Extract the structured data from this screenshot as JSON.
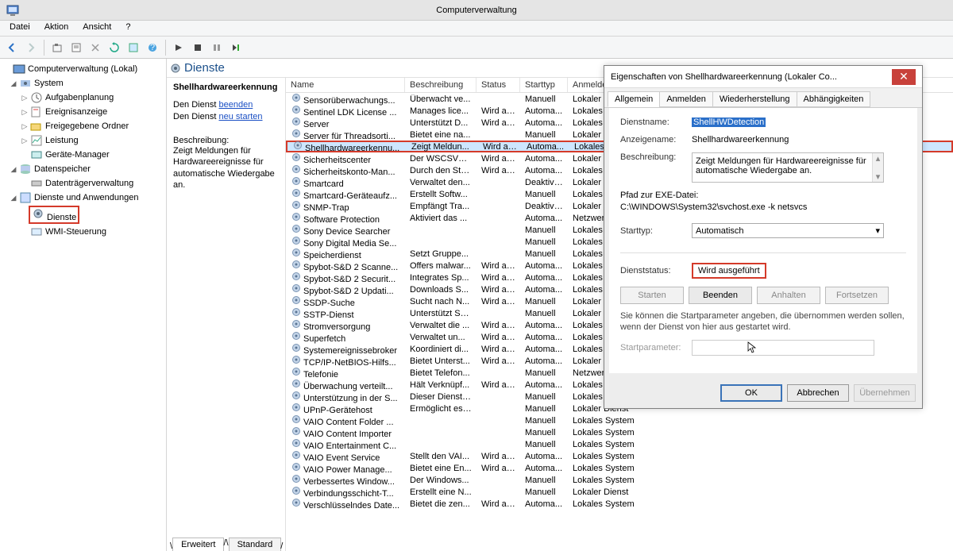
{
  "window_title": "Computerverwaltung",
  "menubar": [
    "Datei",
    "Aktion",
    "Ansicht",
    "?"
  ],
  "tree": {
    "root": "Computerverwaltung (Lokal)",
    "system": "System",
    "aufgaben": "Aufgabenplanung",
    "ereignis": "Ereignisanzeige",
    "freigabe": "Freigegebene Ordner",
    "leistung": "Leistung",
    "geraete": "Geräte-Manager",
    "datenspeicher": "Datenspeicher",
    "datentraeger": "Datenträgerverwaltung",
    "dienste_anw": "Dienste und Anwendungen",
    "dienste": "Dienste",
    "wmi": "WMI-Steuerung"
  },
  "pane": {
    "header": "Dienste",
    "selected": "Shellhardwareerkennung",
    "stop_pre": "Den Dienst ",
    "beenden": "beenden",
    "neustarten": "neu starten",
    "desc_lbl": "Beschreibung:",
    "desc": "Zeigt Meldungen für Hardwareereignisse für automatische Wiedergabe an."
  },
  "cols": {
    "name": "Name",
    "desc": "Beschreibung",
    "status": "Status",
    "start": "Starttyp",
    "logon": "Anmelden als"
  },
  "rows": [
    {
      "n": "Sensorüberwachungs...",
      "d": "Überwacht ve...",
      "s": "",
      "t": "Manuell",
      "l": "Lokaler Dienst"
    },
    {
      "n": "Sentinel LDK License ...",
      "d": "Manages lice...",
      "s": "Wird au...",
      "t": "Automa...",
      "l": "Lokales System"
    },
    {
      "n": "Server",
      "d": "Unterstützt D...",
      "s": "Wird au...",
      "t": "Automa...",
      "l": "Lokales System"
    },
    {
      "n": "Server für Threadsorti...",
      "d": "Bietet eine na...",
      "s": "",
      "t": "Manuell",
      "l": "Lokaler Dienst"
    },
    {
      "n": "Shellhardwareerkennu...",
      "d": "Zeigt Meldun...",
      "s": "Wird au...",
      "t": "Automa...",
      "l": "Lokales System"
    },
    {
      "n": "Sicherheitscenter",
      "d": "Der WSCSVC-...",
      "s": "Wird au...",
      "t": "Automa...",
      "l": "Lokaler Dienst"
    },
    {
      "n": "Sicherheitskonto-Man...",
      "d": "Durch den Sta...",
      "s": "Wird au...",
      "t": "Automa...",
      "l": "Lokales System"
    },
    {
      "n": "Smartcard",
      "d": "Verwaltet den...",
      "s": "",
      "t": "Deaktivi...",
      "l": "Lokaler Dienst"
    },
    {
      "n": "Smartcard-Geräteaufz...",
      "d": "Erstellt Softw...",
      "s": "",
      "t": "Manuell",
      "l": "Lokales System"
    },
    {
      "n": "SNMP-Trap",
      "d": "Empfängt Tra...",
      "s": "",
      "t": "Deaktivi...",
      "l": "Lokaler Dienst"
    },
    {
      "n": "Software Protection",
      "d": "Aktiviert das ...",
      "s": "",
      "t": "Automa...",
      "l": "Netzwerkdienst"
    },
    {
      "n": "Sony Device Searcher",
      "d": "",
      "s": "",
      "t": "Manuell",
      "l": "Lokales System"
    },
    {
      "n": "Sony Digital Media Se...",
      "d": "",
      "s": "",
      "t": "Manuell",
      "l": "Lokales System"
    },
    {
      "n": "Speicherdienst",
      "d": "Setzt Gruppe...",
      "s": "",
      "t": "Manuell",
      "l": "Lokales System"
    },
    {
      "n": "Spybot-S&D 2 Scanne...",
      "d": "Offers malwar...",
      "s": "Wird au...",
      "t": "Automa...",
      "l": "Lokales System"
    },
    {
      "n": "Spybot-S&D 2 Securit...",
      "d": "Integrates Sp...",
      "s": "Wird au...",
      "t": "Automa...",
      "l": "Lokales System"
    },
    {
      "n": "Spybot-S&D 2 Updati...",
      "d": "Downloads S...",
      "s": "Wird au...",
      "t": "Automa...",
      "l": "Lokales System"
    },
    {
      "n": "SSDP-Suche",
      "d": "Sucht nach N...",
      "s": "Wird au...",
      "t": "Manuell",
      "l": "Lokaler Dienst"
    },
    {
      "n": "SSTP-Dienst",
      "d": "Unterstützt SS...",
      "s": "",
      "t": "Manuell",
      "l": "Lokaler Dienst"
    },
    {
      "n": "Stromversorgung",
      "d": "Verwaltet die ...",
      "s": "Wird au...",
      "t": "Automa...",
      "l": "Lokales System"
    },
    {
      "n": "Superfetch",
      "d": "Verwaltet un...",
      "s": "Wird au...",
      "t": "Automa...",
      "l": "Lokales System"
    },
    {
      "n": "Systemereignissebroker",
      "d": "Koordiniert di...",
      "s": "Wird au...",
      "t": "Automa...",
      "l": "Lokales System"
    },
    {
      "n": "TCP/IP-NetBIOS-Hilfs...",
      "d": "Bietet Unterst...",
      "s": "Wird au...",
      "t": "Automa...",
      "l": "Lokaler Dienst"
    },
    {
      "n": "Telefonie",
      "d": "Bietet Telefon...",
      "s": "",
      "t": "Manuell",
      "l": "Netzwerkdienst"
    },
    {
      "n": "Überwachung verteilt...",
      "d": "Hält Verknüpf...",
      "s": "Wird au...",
      "t": "Automa...",
      "l": "Lokales System"
    },
    {
      "n": "Unterstützung in der S...",
      "d": "Dieser Dienst ...",
      "s": "",
      "t": "Manuell",
      "l": "Lokales System"
    },
    {
      "n": "UPnP-Gerätehost",
      "d": "Ermöglicht es,...",
      "s": "",
      "t": "Manuell",
      "l": "Lokaler Dienst"
    },
    {
      "n": "VAIO Content Folder ...",
      "d": "",
      "s": "",
      "t": "Manuell",
      "l": "Lokales System"
    },
    {
      "n": "VAIO Content Importer",
      "d": "",
      "s": "",
      "t": "Manuell",
      "l": "Lokales System"
    },
    {
      "n": "VAIO Entertainment C...",
      "d": "",
      "s": "",
      "t": "Manuell",
      "l": "Lokales System"
    },
    {
      "n": "VAIO Event Service",
      "d": "Stellt den VAI...",
      "s": "Wird au...",
      "t": "Automa...",
      "l": "Lokales System"
    },
    {
      "n": "VAIO Power Manage...",
      "d": "Bietet eine En...",
      "s": "Wird au...",
      "t": "Automa...",
      "l": "Lokales System"
    },
    {
      "n": "Verbessertes Window...",
      "d": "Der Windows...",
      "s": "",
      "t": "Manuell",
      "l": "Lokales System"
    },
    {
      "n": "Verbindungsschicht-T...",
      "d": "Erstellt eine N...",
      "s": "",
      "t": "Manuell",
      "l": "Lokaler Dienst"
    },
    {
      "n": "Verschlüsselndes Date...",
      "d": "Bietet die zen...",
      "s": "Wird au...",
      "t": "Automa...",
      "l": "Lokales System"
    }
  ],
  "bottom_tabs": {
    "ext": "Erweitert",
    "std": "Standard"
  },
  "dialog": {
    "title": "Eigenschaften von Shellhardwareerkennung (Lokaler Co...",
    "tabs": {
      "general": "Allgemein",
      "logon": "Anmelden",
      "recovery": "Wiederherstellung",
      "deps": "Abhängigkeiten"
    },
    "svc_name_lbl": "Dienstname:",
    "svc_name": "ShellHWDetection",
    "disp_lbl": "Anzeigename:",
    "disp": "Shellhardwareerkennung",
    "desc_lbl": "Beschreibung:",
    "desc": "Zeigt Meldungen für Hardwareereignisse für automatische Wiedergabe an.",
    "exe_lbl": "Pfad zur EXE-Datei:",
    "exe": "C:\\WINDOWS\\System32\\svchost.exe -k netsvcs",
    "start_lbl": "Starttyp:",
    "start": "Automatisch",
    "status_lbl": "Dienststatus:",
    "status": "Wird ausgeführt",
    "btn_start": "Starten",
    "btn_stop": "Beenden",
    "btn_pause": "Anhalten",
    "btn_resume": "Fortsetzen",
    "hint": "Sie können die Startparameter angeben, die übernommen werden sollen, wenn der Dienst von hier aus gestartet wird.",
    "param_lbl": "Startparameter:",
    "ok": "OK",
    "cancel": "Abbrechen",
    "apply": "Übernehmen"
  }
}
